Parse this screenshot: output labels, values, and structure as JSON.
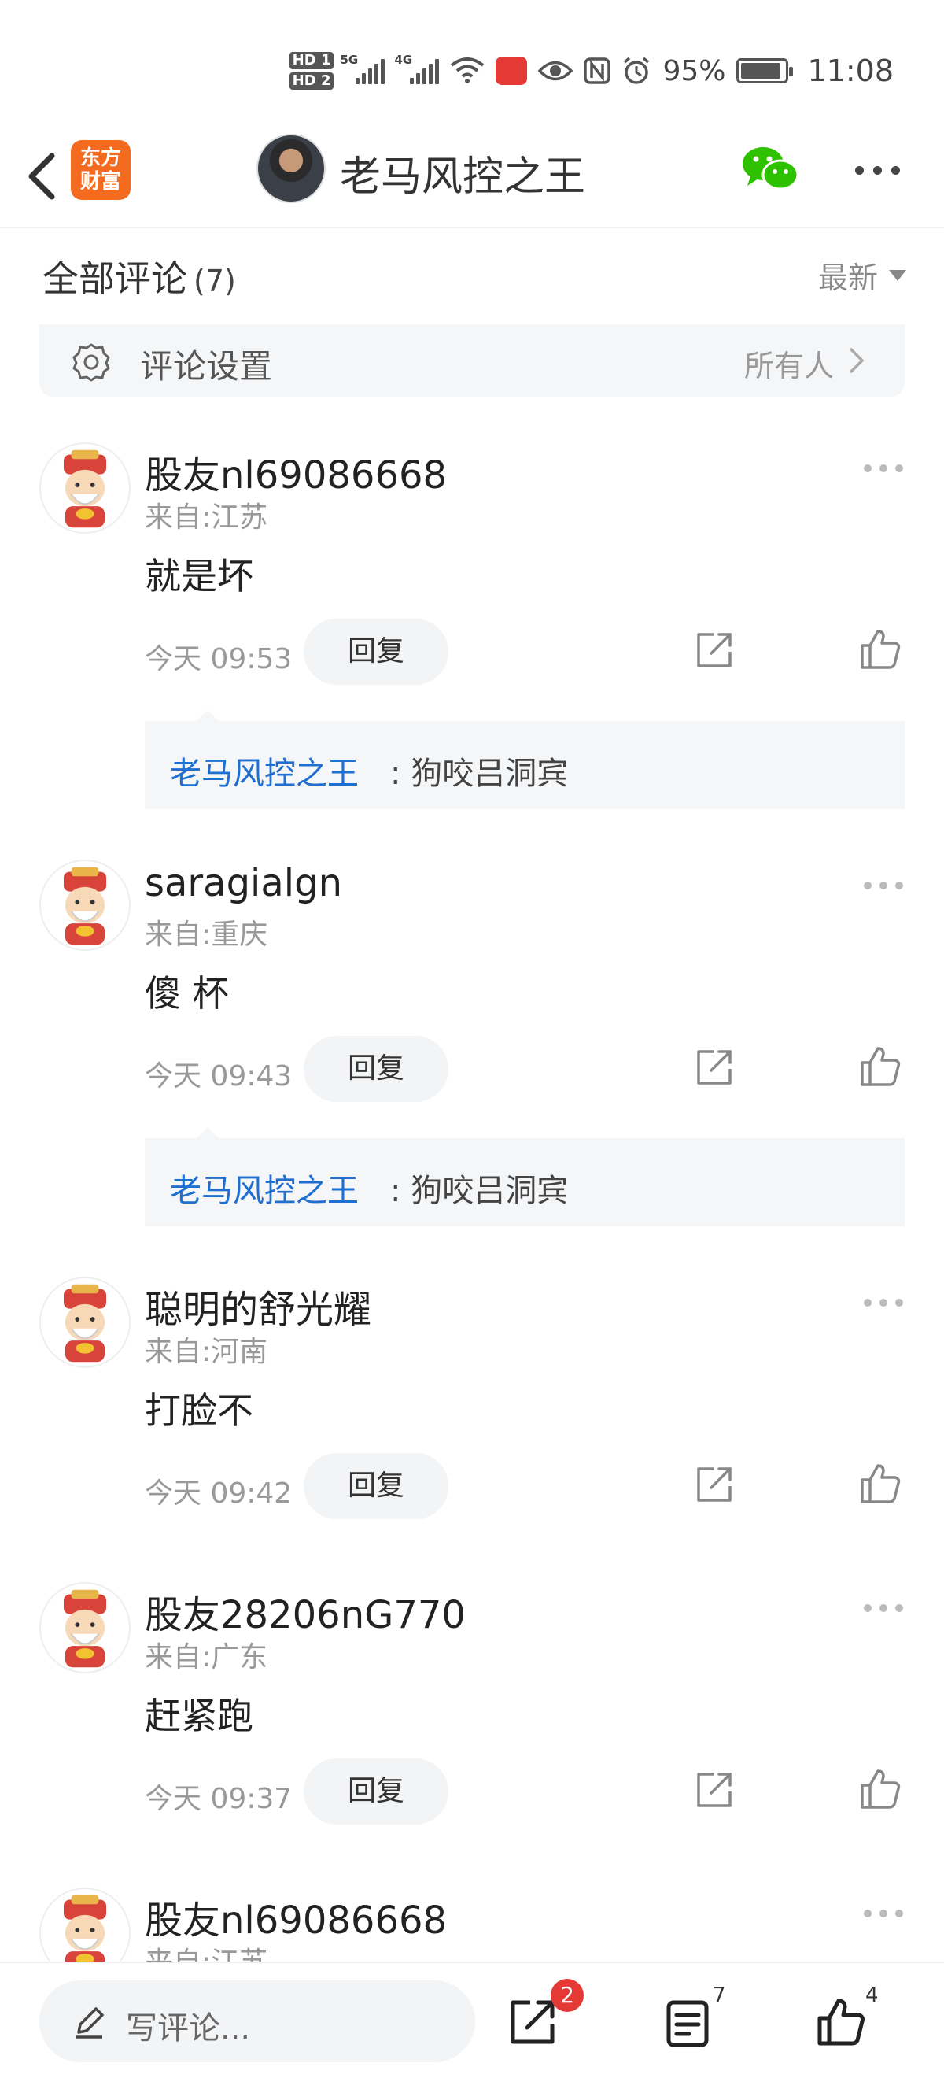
{
  "status_bar": {
    "hd1": "HD 1",
    "hd2": "HD 2",
    "net1": "5G",
    "net2": "4G",
    "nfc": "N",
    "battery_pct": "95%",
    "time": "11:08",
    "battery_level": 0.95
  },
  "header": {
    "logo_line1": "东方",
    "logo_line2": "财富",
    "title": "老马风控之王"
  },
  "comments_header": {
    "label": "全部评论",
    "count": "(7)",
    "sort": "最新"
  },
  "settings": {
    "label": "评论设置",
    "value": "所有人"
  },
  "reply_label": "回复",
  "comments": [
    {
      "name": "股友nl69086668",
      "location": "来自:江苏",
      "text": "就是坏",
      "time": "今天 09:53",
      "sub_reply": {
        "author": "老马风控之王",
        "text": ": 狗咬吕洞宾"
      }
    },
    {
      "name": "saragialgn",
      "location": "来自:重庆",
      "text": "傻 杯",
      "time": "今天 09:43",
      "sub_reply": {
        "author": "老马风控之王",
        "text": ": 狗咬吕洞宾"
      }
    },
    {
      "name": "聪明的舒光耀",
      "location": "来自:河南",
      "text": "打脸不",
      "time": "今天 09:42"
    },
    {
      "name": "股友28206nG770",
      "location": "来自:广东",
      "text": "赶紧跑",
      "time": "今天 09:37"
    },
    {
      "name": "股友nl69086668",
      "location": "来自:江苏"
    }
  ],
  "bottom_bar": {
    "compose_placeholder": "写评论...",
    "share_badge": "2",
    "comment_count": "7",
    "like_count": "4"
  },
  "colors": {
    "brand_orange": "#f46b1f",
    "link_blue": "#1e6fd0",
    "badge_red": "#e53935",
    "wechat_green": "#2dc100"
  }
}
